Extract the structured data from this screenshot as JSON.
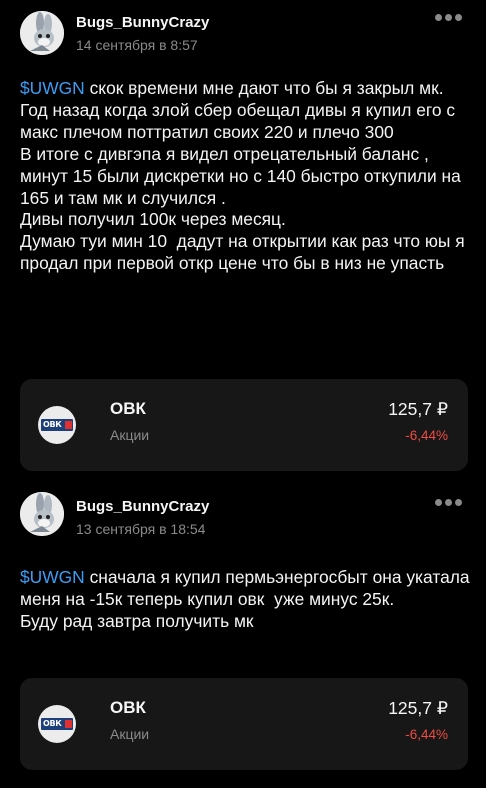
{
  "posts": [
    {
      "author": "Bugs_BunnyCrazy",
      "date": "14 сентября в 8:57",
      "ticker": "$UWGN",
      "text": " скок времени мне дают что бы я закрыл мк.\nГод назад когда злой сбер обещал дивы я купил его с макс плечом поттратил своих 220 и плечо 300\nВ итоге с дивгэпа я видел отрецательный баланс , минут 15 были дискретки но с 140 быстро откупили на 165 и там мк и случился .\nДивы получил 100к через месяц.\nДумаю туи мин 10  дадут на открытии как раз что юы я продал при первой откр цене что бы в низ не упасть",
      "card": {
        "name": "ОВК",
        "type": "Акции",
        "price": "125,7 ₽",
        "change": "-6,44%",
        "logo_text": "ОВК"
      }
    },
    {
      "author": "Bugs_BunnyCrazy",
      "date": "13 сентября в 18:54",
      "ticker": "$UWGN",
      "text": " сначала я купил пермьэнергосбыт она укатала меня на -15к теперь купил овк  уже минус 25к.\nБуду рад завтра получить мк",
      "card": {
        "name": "ОВК",
        "type": "Акции",
        "price": "125,7 ₽",
        "change": "-6,44%",
        "logo_text": "ОВК"
      }
    }
  ],
  "colors": {
    "background": "#000000",
    "card": "#171717",
    "ticker": "#3c9df5",
    "negative": "#ec4c43",
    "muted": "#8a8a8a"
  },
  "icons": {
    "avatar": "bunny-avatar",
    "more": "more-dots-icon",
    "logo": "ovk-logo"
  }
}
